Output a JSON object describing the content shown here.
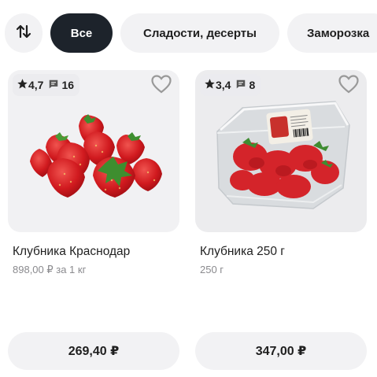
{
  "filters": {
    "sort_icon": "sort-arrows-icon",
    "chips": [
      {
        "label": "Все",
        "active": true
      },
      {
        "label": "Сладости, десерты",
        "active": false
      },
      {
        "label": "Заморозка",
        "active": false
      }
    ]
  },
  "products": [
    {
      "rating": "4,7",
      "reviews": "16",
      "name": "Клубника Краснодар",
      "price_per_unit": "898,00 ₽ за 1 кг",
      "price": "269,40 ₽",
      "image": "strawberries-pile"
    },
    {
      "rating": "3,4",
      "reviews": "8",
      "name": "Клубника 250 г",
      "weight": "250 г",
      "price": "347,00 ₽",
      "image": "strawberries-in-plastic-box"
    }
  ],
  "colors": {
    "chip_active_bg": "#1d232b",
    "chip_bg": "#f2f2f4",
    "card_bg": "#f1f1f3",
    "accent_red": "#d71920"
  }
}
